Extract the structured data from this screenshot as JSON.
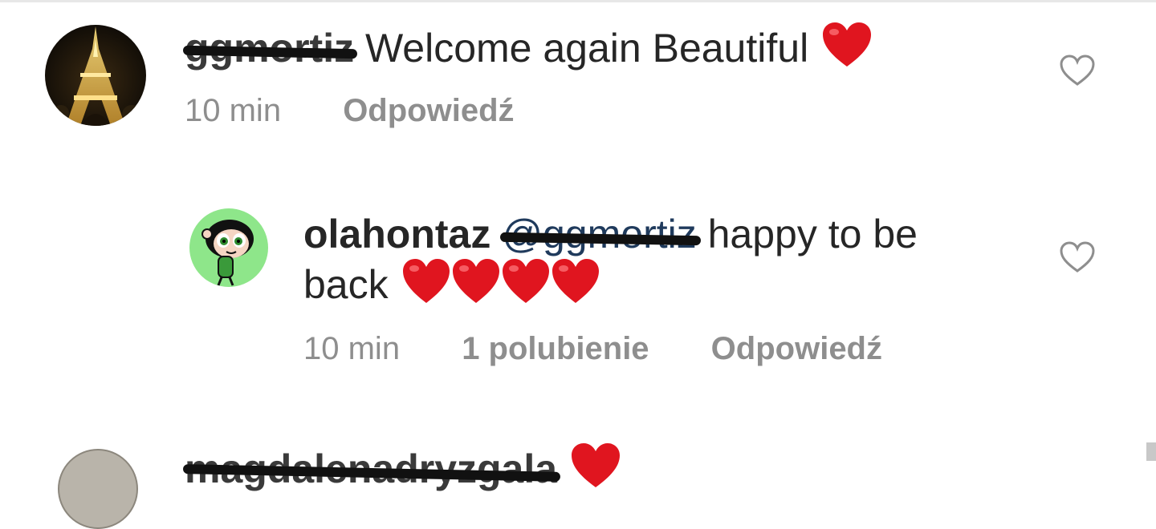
{
  "comments": [
    {
      "username": "ggmortiz",
      "text": "Welcome again Beautiful",
      "emoji": "❤️",
      "time": "10 min",
      "reply_label": "Odpowiedź"
    },
    {
      "username": "olahontaz",
      "mention": "@ggmortiz",
      "text_line1": "happy to be",
      "text_line2": "back",
      "emoji": "❤️❤️❤️❤️",
      "time": "10 min",
      "likes": "1 polubienie",
      "reply_label": "Odpowiedź"
    },
    {
      "username": "magdalenadryzgala",
      "emoji": "❤️"
    }
  ],
  "icons": {
    "like": "heart-outline-icon",
    "emoji": "red-heart-icon"
  },
  "colors": {
    "text": "#262626",
    "meta": "#8e8e8e",
    "heart": "#e0151f",
    "mention": "#1f3a5c"
  }
}
